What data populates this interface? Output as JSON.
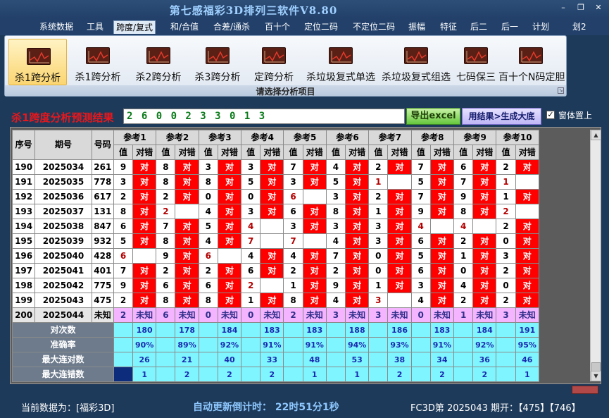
{
  "app": {
    "title": "第七感福彩3D排列三软件V8.80"
  },
  "window": {
    "minimize_icon": "minimize-icon",
    "restore_icon": "restore-icon",
    "close_icon": "close-icon"
  },
  "menu": [
    {
      "label": "系统数据",
      "active": false
    },
    {
      "label": "工具",
      "active": false
    },
    {
      "label": "跨度/复式",
      "active": true
    },
    {
      "label": "和/合值",
      "active": false
    },
    {
      "label": "合差/通杀",
      "active": false
    },
    {
      "label": "百十个",
      "active": false
    },
    {
      "label": "定位二码",
      "active": false
    },
    {
      "label": "不定位二码",
      "active": false
    },
    {
      "label": "振幅",
      "active": false
    },
    {
      "label": "特征",
      "active": false
    },
    {
      "label": "后二",
      "active": false
    },
    {
      "label": "后一",
      "active": false
    },
    {
      "label": "计划",
      "active": false
    },
    {
      "label": "划2",
      "active": false
    }
  ],
  "ribbon": {
    "buttons": [
      {
        "label": "杀1跨分析",
        "active": true,
        "icon": "chart-icon"
      },
      {
        "label": "杀1跨分析",
        "active": false,
        "icon": "chart-icon"
      },
      {
        "label": "杀2跨分析",
        "active": false,
        "icon": "chart-icon"
      },
      {
        "label": "杀3跨分析",
        "active": false,
        "icon": "chart-icon"
      },
      {
        "label": "定跨分析",
        "active": false,
        "icon": "chart-icon"
      },
      {
        "label": "杀垃圾复式单选",
        "active": false,
        "icon": "chart-icon"
      },
      {
        "label": "杀垃圾复式组选",
        "active": false,
        "icon": "chart-icon"
      },
      {
        "label": "七码保三",
        "active": false,
        "icon": "chart-icon"
      },
      {
        "label": "百十个N码定胆",
        "active": false,
        "icon": "chart-icon"
      }
    ],
    "group_label": "请选择分析项目"
  },
  "result": {
    "label": "杀1跨度分析预测结果",
    "value": "2 6 0 0 2 3 3 0 1 3",
    "export_button": "导出excel",
    "generate_button": "用结果>生成大底",
    "pin_label": "窗体置上",
    "pin_checked": true
  },
  "grid": {
    "headers": {
      "seq": "序号",
      "issue": "期号",
      "number": "号码",
      "refs": [
        "参考1",
        "参考2",
        "参考3",
        "参考4",
        "参考5",
        "参考6",
        "参考7",
        "参考8",
        "参考9",
        "参考10"
      ],
      "val": "值",
      "result": "对错"
    },
    "rows": [
      {
        "seq": "190",
        "issue": "2025034",
        "num": "261",
        "vals": [
          "9",
          "8",
          "3",
          "3",
          "7",
          "4",
          "2",
          "7",
          "6",
          "2"
        ],
        "res": [
          "对",
          "对",
          "对",
          "对",
          "对",
          "对",
          "对",
          "对",
          "对",
          "对"
        ]
      },
      {
        "seq": "191",
        "issue": "2025035",
        "num": "778",
        "vals": [
          "3",
          "8",
          "8",
          "5",
          "3",
          "5",
          "1",
          "5",
          "7",
          "1"
        ],
        "res": [
          "对",
          "对",
          "对",
          "对",
          "对",
          "对",
          "",
          "对",
          "对",
          ""
        ]
      },
      {
        "seq": "192",
        "issue": "2025036",
        "num": "617",
        "vals": [
          "2",
          "2",
          "0",
          "0",
          "6",
          "3",
          "2",
          "7",
          "9",
          "1"
        ],
        "res": [
          "对",
          "对",
          "对",
          "对",
          "",
          "对",
          "对",
          "对",
          "对",
          "对"
        ]
      },
      {
        "seq": "193",
        "issue": "2025037",
        "num": "131",
        "vals": [
          "8",
          "2",
          "4",
          "3",
          "6",
          "8",
          "1",
          "9",
          "8",
          "2"
        ],
        "res": [
          "对",
          "",
          "对",
          "对",
          "对",
          "对",
          "对",
          "对",
          "对",
          ""
        ]
      },
      {
        "seq": "194",
        "issue": "2025038",
        "num": "847",
        "vals": [
          "6",
          "7",
          "5",
          "4",
          "3",
          "3",
          "3",
          "4",
          "4",
          "2"
        ],
        "res": [
          "对",
          "对",
          "对",
          "",
          "对",
          "对",
          "对",
          "",
          "",
          "对"
        ]
      },
      {
        "seq": "195",
        "issue": "2025039",
        "num": "932",
        "vals": [
          "5",
          "8",
          "4",
          "7",
          "7",
          "4",
          "3",
          "6",
          "2",
          "0"
        ],
        "res": [
          "对",
          "对",
          "对",
          "",
          "",
          "对",
          "对",
          "对",
          "对",
          "对"
        ]
      },
      {
        "seq": "196",
        "issue": "2025040",
        "num": "428",
        "vals": [
          "6",
          "9",
          "6",
          "4",
          "4",
          "7",
          "0",
          "5",
          "1",
          "3"
        ],
        "res": [
          "",
          "对",
          "",
          "对",
          "对",
          "对",
          "对",
          "对",
          "对",
          "对"
        ]
      },
      {
        "seq": "197",
        "issue": "2025041",
        "num": "401",
        "vals": [
          "7",
          "2",
          "2",
          "6",
          "2",
          "2",
          "0",
          "6",
          "0",
          "2"
        ],
        "res": [
          "对",
          "对",
          "对",
          "对",
          "对",
          "对",
          "对",
          "对",
          "对",
          "对"
        ]
      },
      {
        "seq": "198",
        "issue": "2025042",
        "num": "775",
        "vals": [
          "9",
          "6",
          "6",
          "2",
          "1",
          "9",
          "1",
          "3",
          "4",
          "0"
        ],
        "res": [
          "对",
          "对",
          "对",
          "",
          "对",
          "对",
          "对",
          "对",
          "对",
          "对"
        ]
      },
      {
        "seq": "199",
        "issue": "2025043",
        "num": "475",
        "vals": [
          "2",
          "8",
          "8",
          "1",
          "8",
          "4",
          "3",
          "4",
          "2",
          "2"
        ],
        "res": [
          "对",
          "对",
          "对",
          "对",
          "对",
          "对",
          "",
          "对",
          "对",
          "对"
        ]
      }
    ],
    "last_row": {
      "seq": "200",
      "issue": "2025044",
      "num": "未知",
      "vals": [
        "2",
        "6",
        "0",
        "0",
        "2",
        "3",
        "3",
        "0",
        "1",
        "3"
      ],
      "res": [
        "未知",
        "未知",
        "未知",
        "未知",
        "未知",
        "未知",
        "未知",
        "未知",
        "未知",
        "未知"
      ]
    },
    "stats": [
      {
        "label": "对次数",
        "vals": [
          "180",
          "178",
          "184",
          "183",
          "183",
          "188",
          "186",
          "183",
          "184",
          "191"
        ]
      },
      {
        "label": "准确率",
        "vals": [
          "90%",
          "89%",
          "92%",
          "91%",
          "91%",
          "94%",
          "93%",
          "91%",
          "92%",
          "95%"
        ]
      },
      {
        "label": "最大连对数",
        "vals": [
          "26",
          "21",
          "40",
          "33",
          "48",
          "53",
          "38",
          "34",
          "36",
          "46"
        ]
      },
      {
        "label": "最大连错数",
        "vals": [
          "1",
          "2",
          "2",
          "2",
          "1",
          "1",
          "2",
          "2",
          "2",
          "1"
        ]
      }
    ]
  },
  "status": {
    "current": "当前数据为：[福彩3D]",
    "countdown": "自动更新倒计时：  22时51分1秒",
    "latest": "FC3D第 2025043 期开：【475】【746】"
  }
}
